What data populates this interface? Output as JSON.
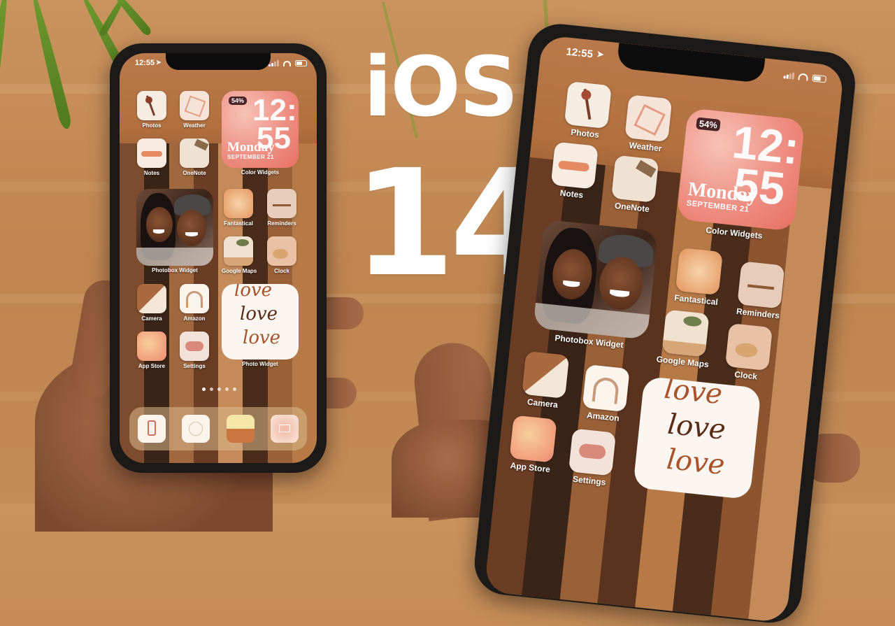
{
  "headline": {
    "line1": "iOS",
    "line2": "14"
  },
  "phones": [
    {
      "id": "left-phone",
      "status": {
        "time": "12:55",
        "location_icon": "location-arrow-icon",
        "signal_bars_on": 2,
        "signal_bars_total": 4,
        "wifi_icon": "wifi-icon",
        "battery_level": 0.54
      },
      "apps": [
        {
          "label": "Photos",
          "icon": "dried-flower-icon",
          "color": "#f5ece2"
        },
        {
          "label": "Weather",
          "icon": "geometric-frame-icon",
          "color": "#f6e3d8"
        },
        {
          "label": "Notes",
          "icon": "triangle-brush-icon",
          "color": "#f7ebe2"
        },
        {
          "label": "OneNote",
          "icon": "books-icon",
          "color": "#efe2d2"
        },
        {
          "label": "Fantastical",
          "icon": "coffee-cup-icon",
          "color": "#f0b98a"
        },
        {
          "label": "Reminders",
          "icon": "dried-grass-icon",
          "color": "#e7cdb9"
        },
        {
          "label": "Google Maps",
          "icon": "plant-desk-icon",
          "color": "#f1e2d0"
        },
        {
          "label": "Clock",
          "icon": "record-player-icon",
          "color": "#e8c1a6"
        },
        {
          "label": "Camera",
          "icon": "sunglasses-icon",
          "color": "#c38b5e"
        },
        {
          "label": "Amazon",
          "icon": "rainbow-icon",
          "color": "#fbf5ee"
        },
        {
          "label": "App Store",
          "icon": "pink-clouds-icon",
          "color": "#ee9c80"
        },
        {
          "label": "Settings",
          "icon": "cloud-frame-icon",
          "color": "#f3e2d9"
        }
      ],
      "widgets": {
        "color_widget": {
          "label": "Color Widgets",
          "battery": "54%",
          "time_hours": "12:",
          "time_minutes": "55",
          "day": "Monday",
          "date": "SEPTEMBER 21"
        },
        "photobox": {
          "label": "Photobox Widget"
        },
        "photo_widget": {
          "label": "Photo Widget",
          "words": [
            "love",
            "love",
            "love"
          ]
        }
      },
      "page_dots": {
        "count": 5,
        "active": 0
      },
      "dock": [
        {
          "icon": "phone-icon"
        },
        {
          "icon": "compass-icon"
        },
        {
          "icon": "messages-photo-icon"
        },
        {
          "icon": "mail-envelope-icon"
        }
      ]
    },
    {
      "id": "right-phone",
      "status": {
        "time": "12:55",
        "location_icon": "location-arrow-icon",
        "signal_bars_on": 2,
        "signal_bars_total": 4,
        "wifi_icon": "wifi-icon",
        "battery_level": 0.54
      }
    }
  ]
}
